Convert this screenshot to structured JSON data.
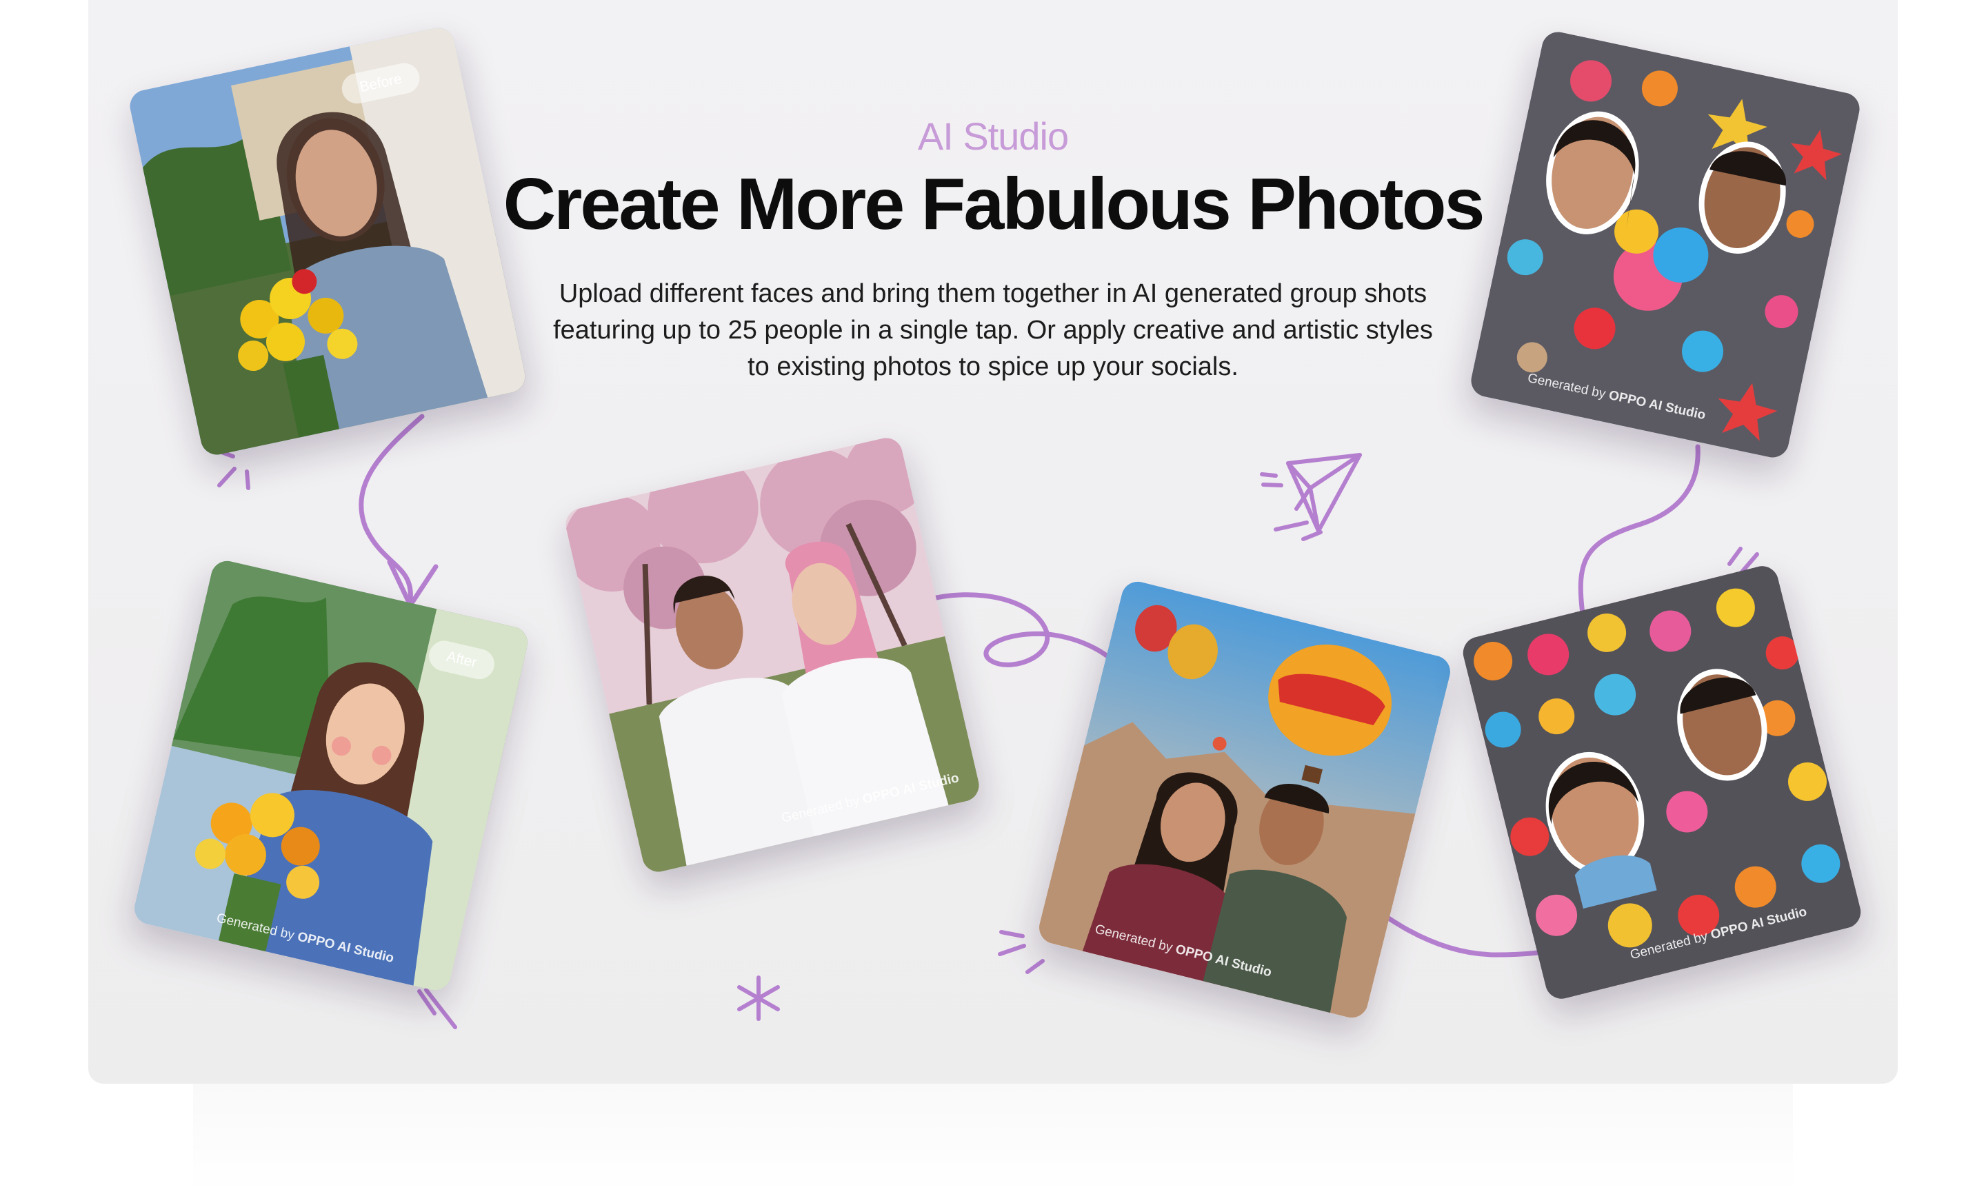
{
  "hero": {
    "eyebrow": "AI Studio",
    "headline": "Create More Fabulous Photos",
    "description": "Upload different faces and bring them together in AI generated group shots featuring up to 25 people in a single tap. Or apply creative and artistic styles to existing photos to spice up your socials."
  },
  "cards": [
    {
      "label": "Before",
      "scene": "woman with yellow flower bouquet beside white wall"
    },
    {
      "label": "After",
      "watermark_prefix": "Generated by",
      "watermark_brand": "OPPO AI Studio",
      "scene": "painted-style woman with flower bouquet"
    },
    {
      "watermark_prefix": "Generated by",
      "watermark_brand": "OPPO AI Studio",
      "scene": "couple under cherry blossom trees"
    },
    {
      "watermark_prefix": "Generated by",
      "watermark_brand": "OPPO AI Studio",
      "scene": "couple selfie with hot air balloons"
    },
    {
      "watermark_prefix": "Generated by",
      "watermark_brand": "OPPO AI Studio",
      "scene": "portrait stickers on grey board"
    },
    {
      "watermark_prefix": "Generated by",
      "watermark_brand": "OPPO AI Studio",
      "scene": "portrait stickers collage with cartoon stickers"
    }
  ],
  "colors": {
    "accent_purple": "#b57fd0",
    "eyebrow": "#c79ad8",
    "headline": "#0d0d0d"
  },
  "icons": [
    "paper-plane-icon",
    "asterisk-sparkle-icon",
    "arrow-icon"
  ]
}
